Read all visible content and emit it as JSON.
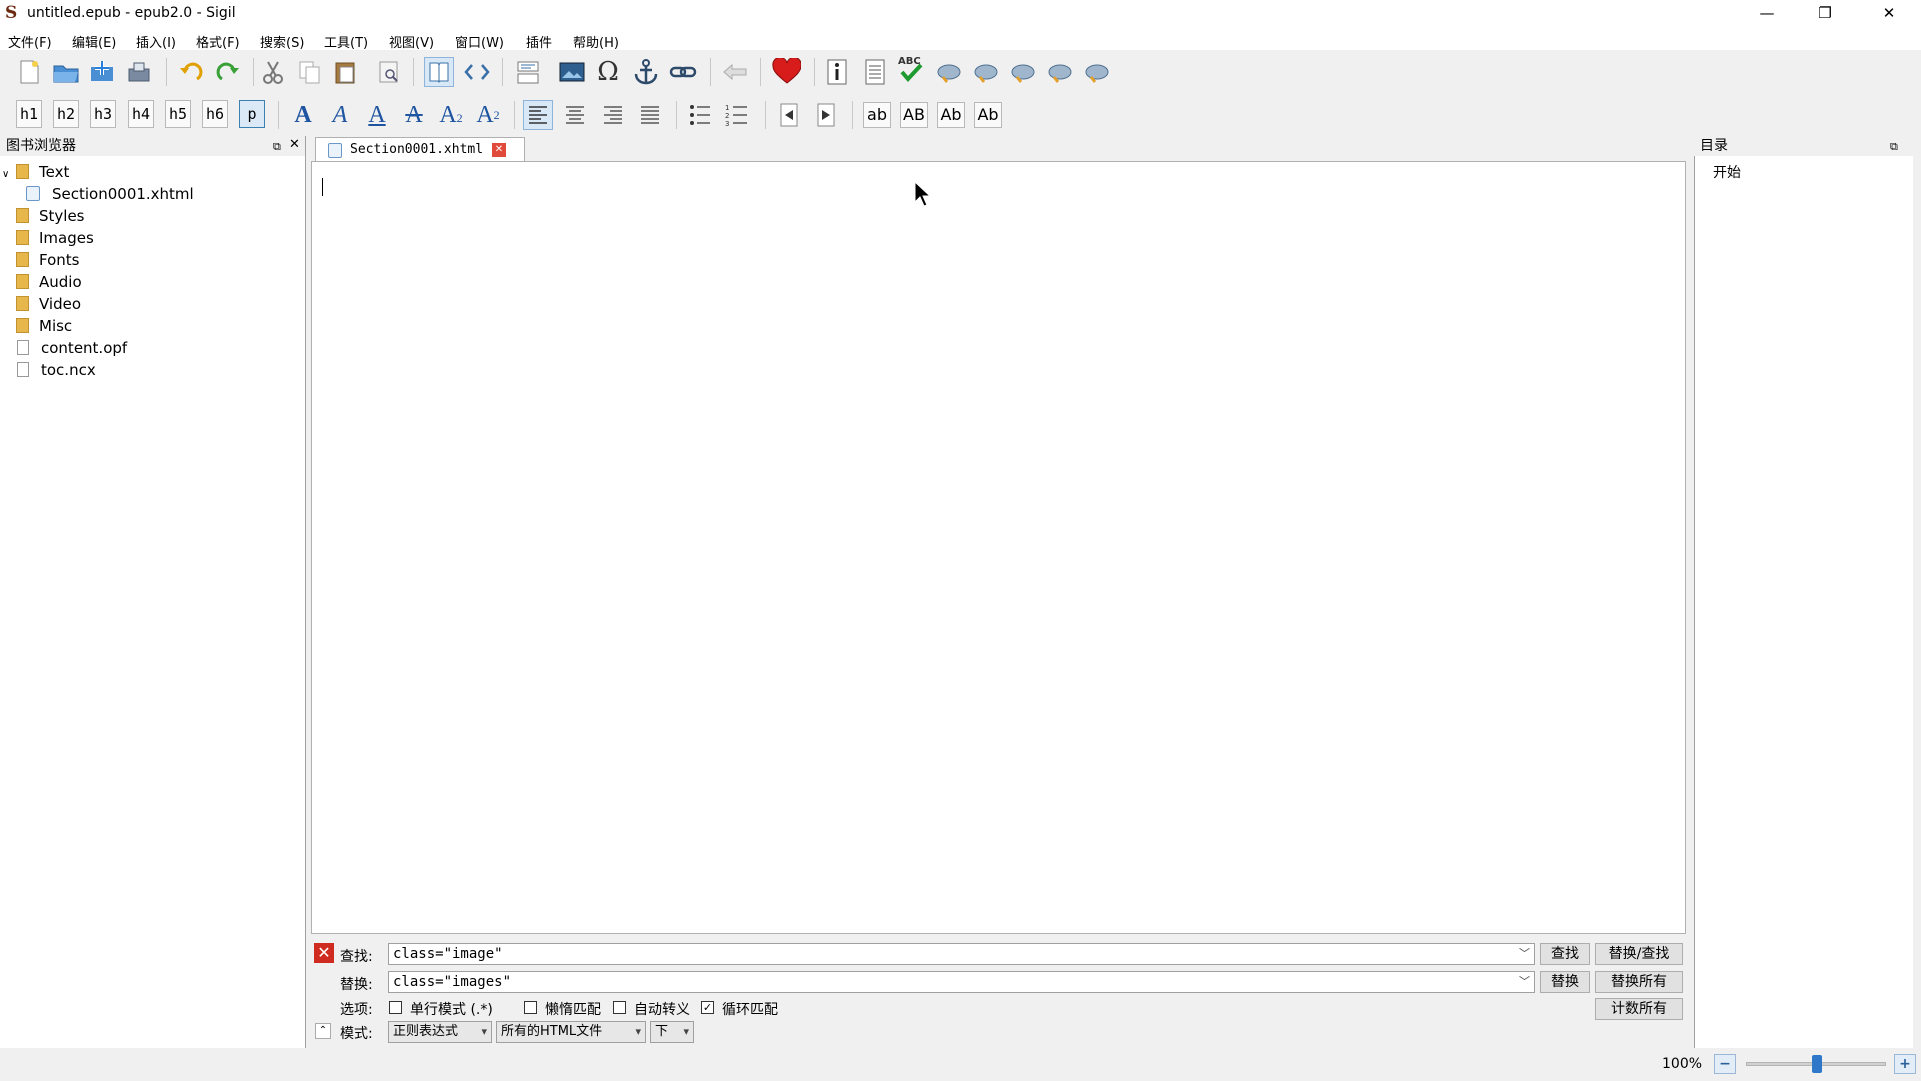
{
  "window": {
    "title": "untitled.epub - epub2.0 - Sigil",
    "minimize_glyph": "—",
    "restore_glyph": "❐",
    "close_glyph": "✕"
  },
  "menu": {
    "items": [
      "文件(F)",
      "编辑(E)",
      "插入(I)",
      "格式(F)",
      "搜索(S)",
      "工具(T)",
      "视图(V)",
      "窗口(W)",
      "插件",
      "帮助(H)"
    ]
  },
  "format_toolbar": {
    "headings": [
      "h1",
      "h2",
      "h3",
      "h4",
      "h5",
      "h6",
      "p"
    ],
    "active_heading": "p",
    "case_buttons": [
      "ab",
      "AB",
      "Ab",
      "Ab"
    ]
  },
  "book_browser": {
    "title": "图书浏览器",
    "tree": {
      "text_folder": "Text",
      "section_file": "Section0001.xhtml",
      "styles": "Styles",
      "images": "Images",
      "fonts": "Fonts",
      "audio": "Audio",
      "video": "Video",
      "misc": "Misc",
      "content_opf": "content.opf",
      "toc_ncx": "toc.ncx"
    }
  },
  "editor": {
    "tab_label": "Section0001.xhtml"
  },
  "toc": {
    "title": "目录",
    "entries": [
      "开始"
    ]
  },
  "find_replace": {
    "find_label": "查找:",
    "find_value": "class=\"image\"",
    "replace_label": "替换:",
    "replace_value": "class=\"images\"",
    "options_label": "选项:",
    "mode_label": "模式:",
    "find_button": "查找",
    "replace_find_button": "替换/查找",
    "replace_button": "替换",
    "replace_all_button": "替换所有",
    "count_all_button": "计数所有",
    "options": {
      "single_line": "单行模式 (.*)",
      "minimal_match": "懒惰匹配",
      "auto_tokenise": "自动转义",
      "wrap": "循环匹配"
    },
    "mode_value": "正则表达式",
    "scope_value": "所有的HTML文件",
    "direction_value": "下"
  },
  "status": {
    "zoom": "100%",
    "zoom_level_fraction": 0.5
  }
}
